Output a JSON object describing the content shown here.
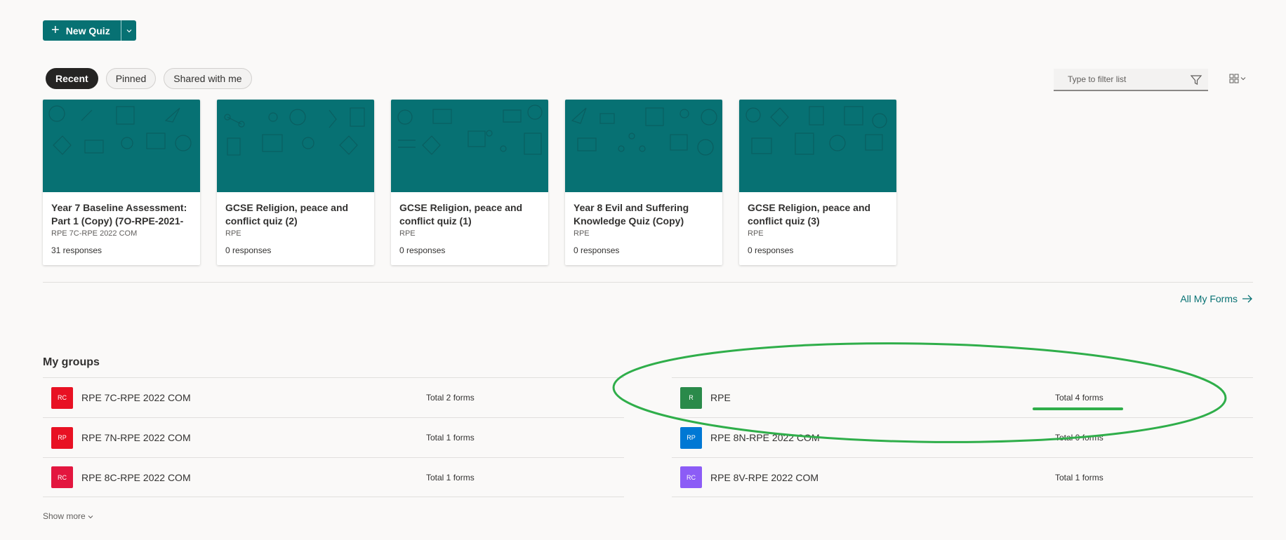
{
  "toolbar": {
    "new_quiz_label": "New Quiz"
  },
  "tabs": [
    {
      "label": "Recent",
      "active": true
    },
    {
      "label": "Pinned",
      "active": false
    },
    {
      "label": "Shared with me",
      "active": false
    }
  ],
  "filter": {
    "placeholder": "Type to filter list"
  },
  "cards": [
    {
      "title": "Year 7 Baseline Assessment: Part 1  (Copy) (7O-RPE-2021-",
      "group": "RPE 7C-RPE 2022 COM",
      "responses": "31 responses"
    },
    {
      "title": "GCSE Religion, peace and conflict quiz (2)",
      "group": "RPE",
      "responses": "0 responses"
    },
    {
      "title": "GCSE Religion, peace and conflict quiz (1)",
      "group": "RPE",
      "responses": "0 responses"
    },
    {
      "title": "Year 8 Evil and Suffering Knowledge Quiz (Copy)",
      "group": "RPE",
      "responses": "0 responses"
    },
    {
      "title": "GCSE Religion, peace and conflict quiz (3)",
      "group": "RPE",
      "responses": "0 responses"
    }
  ],
  "all_forms_label": "All My Forms",
  "groups_title": "My groups",
  "groups": [
    {
      "initials": "RC",
      "name": "RPE 7C-RPE 2022 COM",
      "count": "Total 2 forms",
      "color": "#e81123"
    },
    {
      "initials": "RP",
      "name": "RPE 7N-RPE 2022 COM",
      "count": "Total 1 forms",
      "color": "#e81123"
    },
    {
      "initials": "RC",
      "name": "RPE 8C-RPE 2022 COM",
      "count": "Total 1 forms",
      "color": "#e3163f"
    },
    {
      "initials": "R",
      "name": "RPE",
      "count": "Total 4 forms",
      "color": "#2a8a4a"
    },
    {
      "initials": "RP",
      "name": "RPE 8N-RPE 2022 COM",
      "count": "Total 0 forms",
      "color": "#0078d4"
    },
    {
      "initials": "RC",
      "name": "RPE 8V-RPE 2022 COM",
      "count": "Total 1 forms",
      "color": "#8c5cf6"
    }
  ],
  "show_more_label": "Show more",
  "colors": {
    "accent": "#077173",
    "annotation": "#2fae4a"
  }
}
